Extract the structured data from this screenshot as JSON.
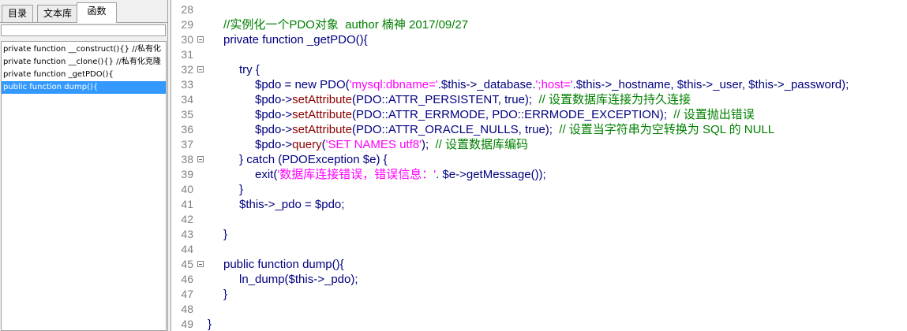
{
  "tabs": [
    "目录",
    "文本库",
    "函数"
  ],
  "active_tab": 2,
  "filter_value": "",
  "functions": [
    "private function __construct(){} //私有化",
    "private function __clone(){} //私有化克隆",
    "private function _getPDO(){",
    "public function dump(){"
  ],
  "selected_function": 3,
  "colors": {
    "keyword": "#000080",
    "comment": "#008000",
    "string": "#ff00ff",
    "method": "#8b0000",
    "line_number": "#808080",
    "selection": "#3399ff"
  },
  "code_lines": [
    {
      "n": "28",
      "fold": false,
      "indent": 0,
      "parts": []
    },
    {
      "n": "29",
      "fold": false,
      "indent": 1,
      "parts": [
        {
          "c": "cm",
          "t": "//实例化一个PDO对象  author 楠神 2017/09/27"
        }
      ]
    },
    {
      "n": "30",
      "fold": true,
      "indent": 1,
      "parts": [
        {
          "c": "kw",
          "t": "private function "
        },
        {
          "c": "tx",
          "t": "_getPDO(){"
        }
      ]
    },
    {
      "n": "31",
      "fold": false,
      "indent": 0,
      "parts": []
    },
    {
      "n": "32",
      "fold": true,
      "indent": 2,
      "parts": [
        {
          "c": "kw",
          "t": "try "
        },
        {
          "c": "tx",
          "t": "{"
        }
      ]
    },
    {
      "n": "33",
      "fold": false,
      "indent": 3,
      "parts": [
        {
          "c": "vr",
          "t": "$pdo = new PDO("
        },
        {
          "c": "st",
          "t": "'mysql:dbname='"
        },
        {
          "c": "tx",
          "t": ".$this->_database."
        },
        {
          "c": "st",
          "t": "';host='"
        },
        {
          "c": "tx",
          "t": ".$this->_hostname, $this->_user, $this->_password);"
        }
      ]
    },
    {
      "n": "34",
      "fold": false,
      "indent": 3,
      "parts": [
        {
          "c": "vr",
          "t": "$pdo->"
        },
        {
          "c": "fn",
          "t": "setAttribute"
        },
        {
          "c": "tx",
          "t": "(PDO::ATTR_PERSISTENT, true);  "
        },
        {
          "c": "cm",
          "t": "// 设置数据库连接为持久连接"
        }
      ]
    },
    {
      "n": "35",
      "fold": false,
      "indent": 3,
      "parts": [
        {
          "c": "vr",
          "t": "$pdo->"
        },
        {
          "c": "fn",
          "t": "setAttribute"
        },
        {
          "c": "tx",
          "t": "(PDO::ATTR_ERRMODE, PDO::ERRMODE_EXCEPTION);  "
        },
        {
          "c": "cm",
          "t": "// 设置抛出错误"
        }
      ]
    },
    {
      "n": "36",
      "fold": false,
      "indent": 3,
      "parts": [
        {
          "c": "vr",
          "t": "$pdo->"
        },
        {
          "c": "fn",
          "t": "setAttribute"
        },
        {
          "c": "tx",
          "t": "(PDO::ATTR_ORACLE_NULLS, true);  "
        },
        {
          "c": "cm",
          "t": "// 设置当字符串为空转换为 SQL 的 NULL"
        }
      ]
    },
    {
      "n": "37",
      "fold": false,
      "indent": 3,
      "parts": [
        {
          "c": "vr",
          "t": "$pdo->"
        },
        {
          "c": "fn",
          "t": "query"
        },
        {
          "c": "tx",
          "t": "("
        },
        {
          "c": "st",
          "t": "'SET NAMES utf8'"
        },
        {
          "c": "tx",
          "t": ");  "
        },
        {
          "c": "cm",
          "t": "// 设置数据库编码"
        }
      ]
    },
    {
      "n": "38",
      "fold": true,
      "indent": 2,
      "parts": [
        {
          "c": "tx",
          "t": "} "
        },
        {
          "c": "kw",
          "t": "catch "
        },
        {
          "c": "tx",
          "t": "(PDOException $e) {"
        }
      ]
    },
    {
      "n": "39",
      "fold": false,
      "indent": 3,
      "parts": [
        {
          "c": "tx",
          "t": "exit("
        },
        {
          "c": "st",
          "t": "'数据库连接错误，错误信息：'"
        },
        {
          "c": "tx",
          "t": ". $e->getMessage());"
        }
      ]
    },
    {
      "n": "40",
      "fold": false,
      "indent": 2,
      "parts": [
        {
          "c": "tx",
          "t": "}"
        }
      ]
    },
    {
      "n": "41",
      "fold": false,
      "indent": 2,
      "parts": [
        {
          "c": "vr",
          "t": "$this->_pdo = $pdo;"
        }
      ]
    },
    {
      "n": "42",
      "fold": false,
      "indent": 0,
      "parts": []
    },
    {
      "n": "43",
      "fold": false,
      "indent": 1,
      "parts": [
        {
          "c": "tx",
          "t": "}"
        }
      ]
    },
    {
      "n": "44",
      "fold": false,
      "indent": 0,
      "parts": []
    },
    {
      "n": "45",
      "fold": true,
      "indent": 1,
      "parts": [
        {
          "c": "kw",
          "t": "public function "
        },
        {
          "c": "tx",
          "t": "dump(){"
        }
      ]
    },
    {
      "n": "46",
      "fold": false,
      "indent": 2,
      "parts": [
        {
          "c": "tx",
          "t": "ln_dump($this->_pdo);"
        }
      ]
    },
    {
      "n": "47",
      "fold": false,
      "indent": 1,
      "parts": [
        {
          "c": "tx",
          "t": "}"
        }
      ]
    },
    {
      "n": "48",
      "fold": false,
      "indent": 0,
      "parts": []
    },
    {
      "n": "49",
      "fold": false,
      "indent": 0,
      "parts": [
        {
          "c": "tx",
          "t": "}"
        }
      ]
    }
  ]
}
